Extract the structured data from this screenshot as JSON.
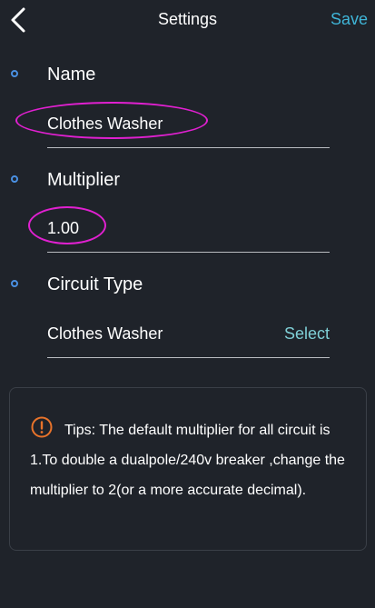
{
  "header": {
    "title": "Settings",
    "save_label": "Save",
    "back_icon": "chevron-left-icon"
  },
  "sections": {
    "name": {
      "label": "Name",
      "value": "Clothes Washer"
    },
    "multiplier": {
      "label": "Multiplier",
      "value": "1.00"
    },
    "circuit_type": {
      "label": "Circuit Type",
      "value": "Clothes Washer",
      "action_label": "Select"
    }
  },
  "tips": {
    "icon": "warning-circle-icon",
    "text": "Tips: The default multiplier for all circuit is 1.To double a dualpole/240v breaker ,change the multiplier to 2(or a more accurate decimal)."
  },
  "colors": {
    "background": "#1f232a",
    "accent": "#3fb5d8",
    "select": "#7fcfd6",
    "bullet": "#4a90e2",
    "annotation": "#e020d0",
    "warning": "#e8732a"
  }
}
